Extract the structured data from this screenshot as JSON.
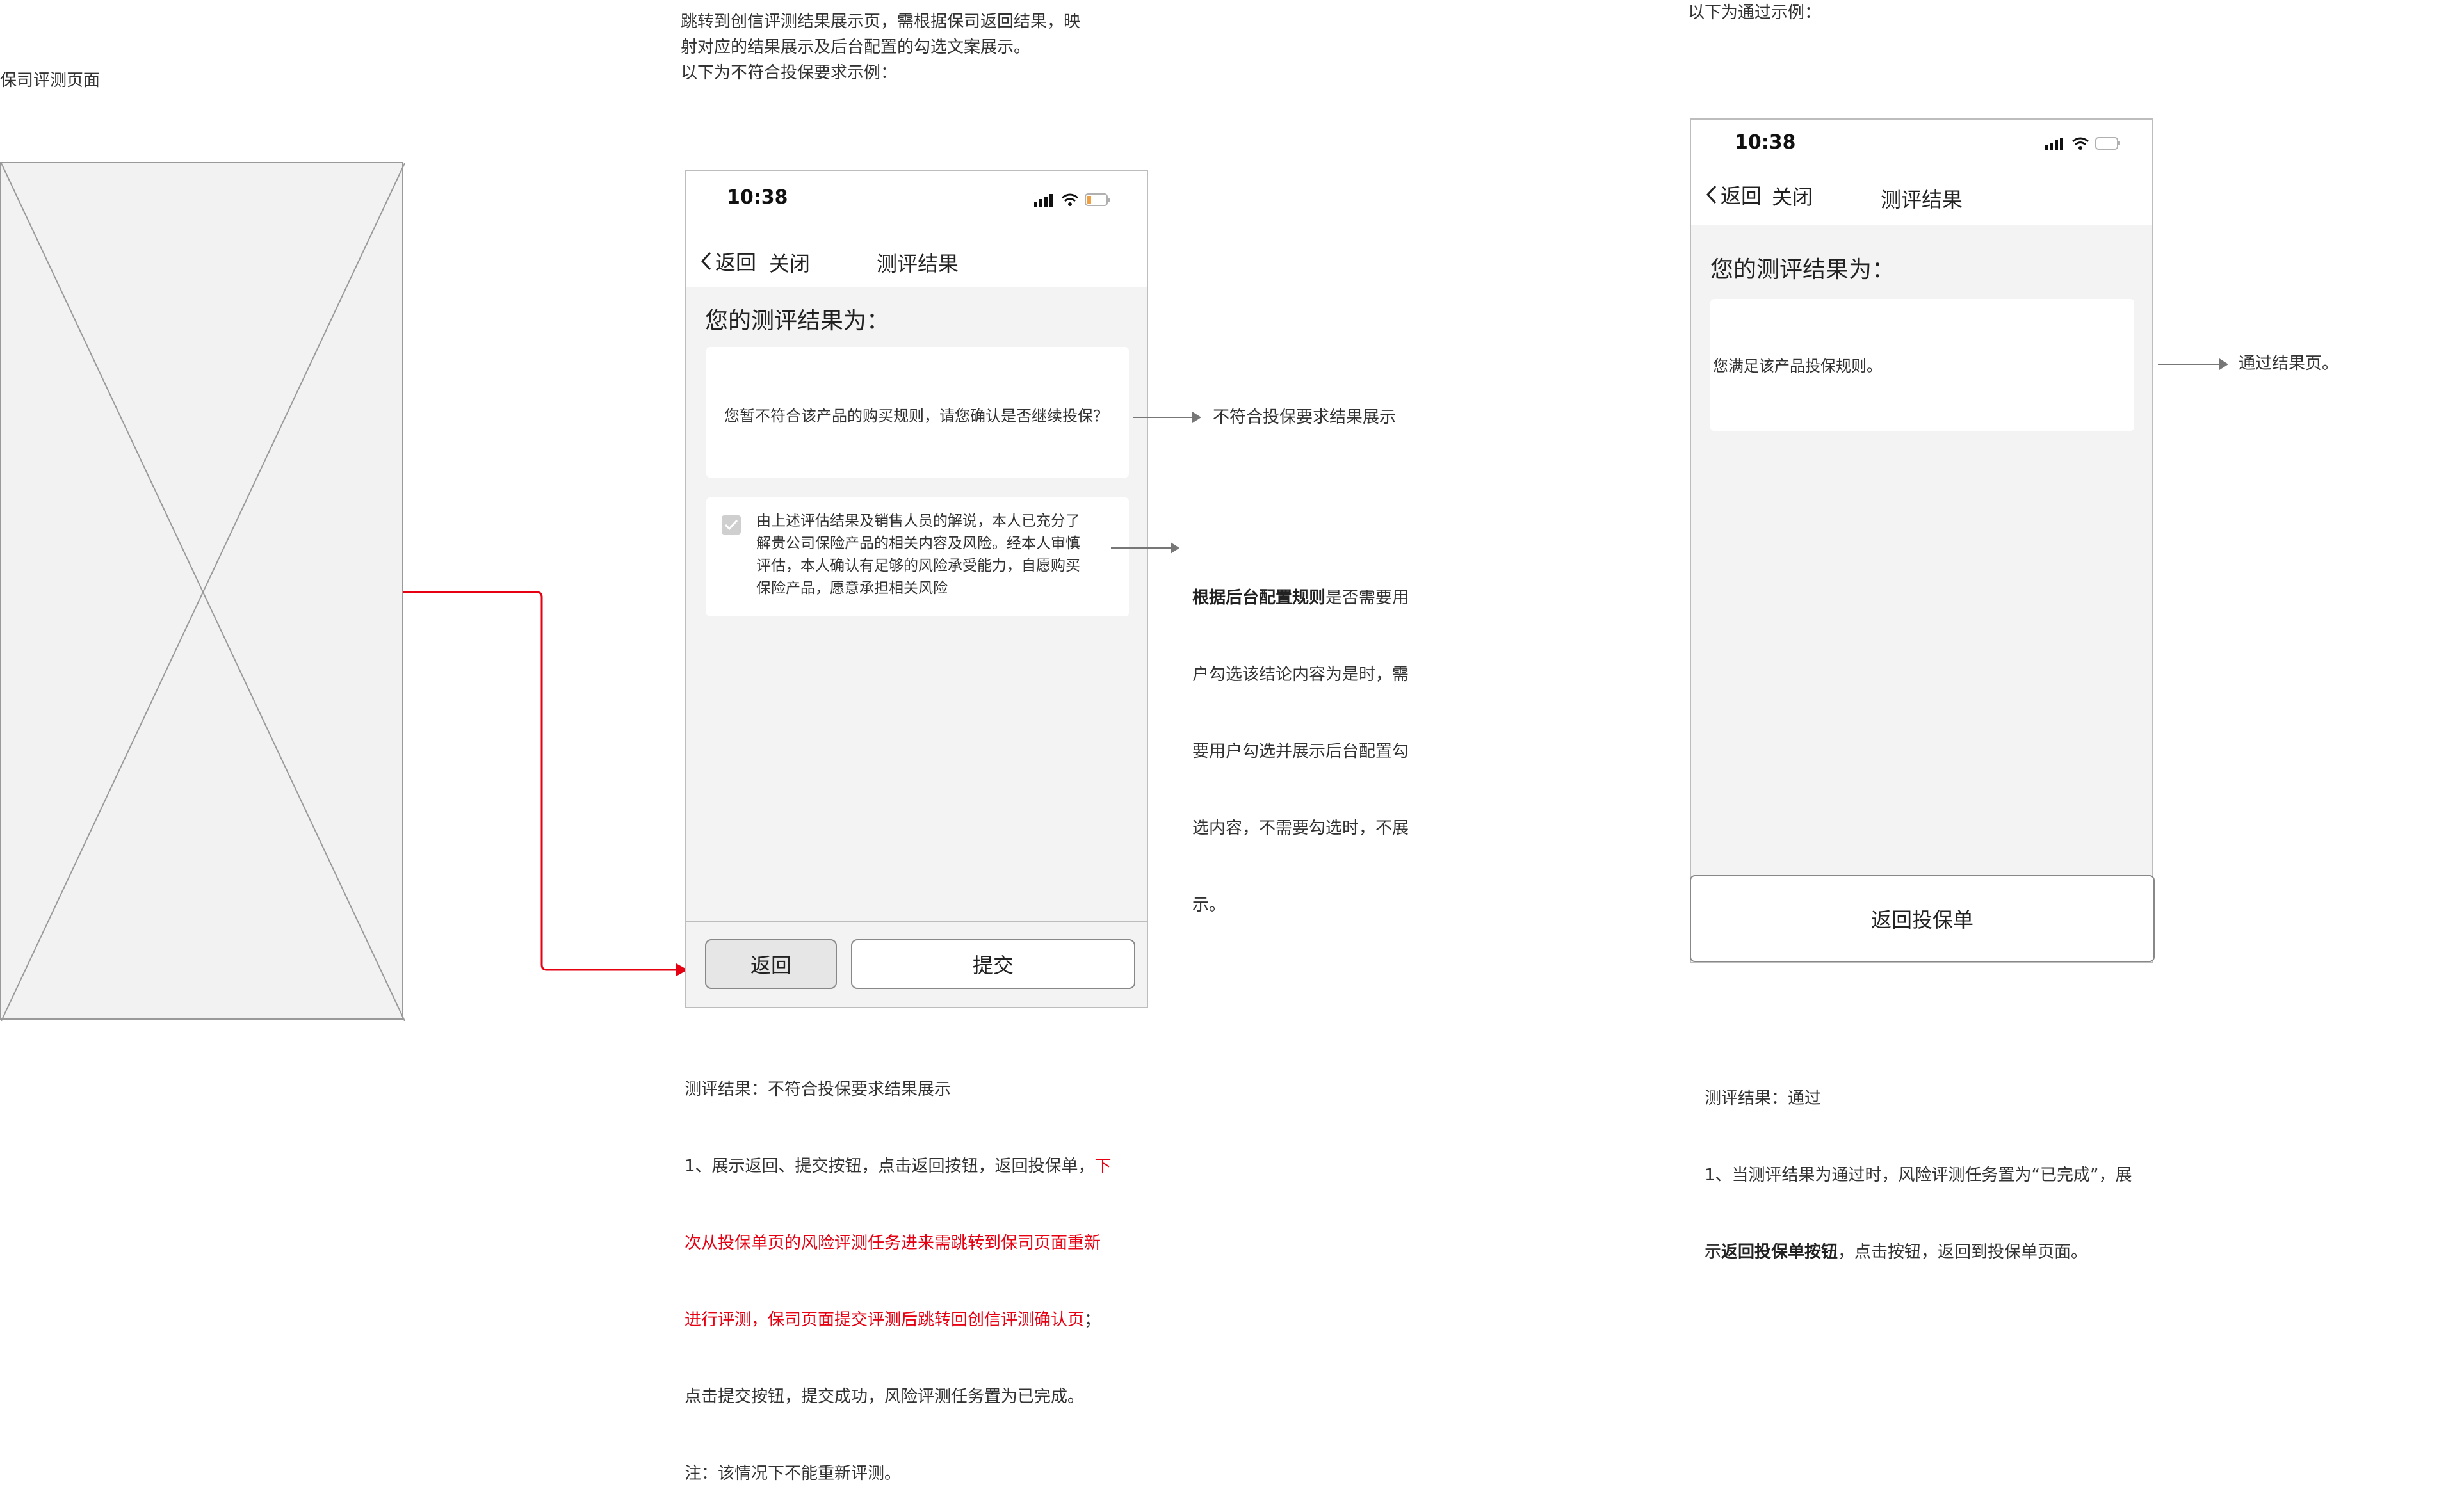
{
  "left": {
    "title": "保司评测页面"
  },
  "middle": {
    "intro_lines": [
      "跳转到创信评测结果展示页，需根据保司返回结果，映",
      "射对应的结果展示及后台配置的勾选文案展示。",
      "以下为不符合投保要求示例："
    ],
    "phone": {
      "time": "10:38",
      "back_label": "返回",
      "close_label": "关闭",
      "title": "测评结果",
      "result_heading": "您的测评结果为：",
      "result_text": "您暂不符合该产品的购买规则，请您确认是否继续投保？",
      "confirm_lines": [
        "由上述评估结果及销售人员的解说，本人已充分了",
        "解贵公司保险产品的相关内容及风险。经本人审慎",
        "评估，本人确认有足够的风险承受能力，自愿购买",
        "保险产品，愿意承担相关风险"
      ],
      "return_button": "返回",
      "submit_button": "提交"
    },
    "annotation_result": "不符合投保要求结果展示",
    "annotation_config_bold": "根据后台配置规则",
    "annotation_config_lines": [
      "是否需要用",
      "户勾选该结论内容为是时，需",
      "要用户勾选并展示后台配置勾",
      "选内容，不需要勾选时，不展",
      "示。"
    ],
    "desc_title": "测评结果：不符合投保要求结果展示",
    "desc_line1_black": "1、展示返回、提交按钮，点击返回按钮，返回投保单，",
    "desc_line1_red": "下",
    "desc_red_lines": [
      "次从投保单页的风险评测任务进来需跳转到保司页面重新",
      "进行评测，保司页面提交评测后跳转回创信评测确认页"
    ],
    "desc_red_suffix": "；",
    "desc_tail_lines": [
      "点击提交按钮，提交成功，风险评测任务置为已完成。",
      "注：该情况下不能重新评测。"
    ]
  },
  "right": {
    "intro": "以下为通过示例：",
    "phone": {
      "time": "10:38",
      "back_label": "返回",
      "close_label": "关闭",
      "title": "测评结果",
      "result_heading": "您的测评结果为：",
      "result_text": "您满足该产品投保规则。",
      "bottom_button": "返回投保单"
    },
    "annotation": "通过结果页。",
    "desc_title": "测评结果：通过",
    "desc_line1": "1、当测评结果为通过时，风险评测任务置为“已完成”，展",
    "desc_line2_prefix": "示",
    "desc_line2_bold": "返回投保单按钮",
    "desc_line2_suffix": "，点击按钮，返回到投保单页面。"
  },
  "colors": {
    "flow_arrow": "#e60012",
    "highlight_text": "#e60012",
    "phone_bg": "#f3f3f3",
    "card_bg": "#ffffff"
  }
}
